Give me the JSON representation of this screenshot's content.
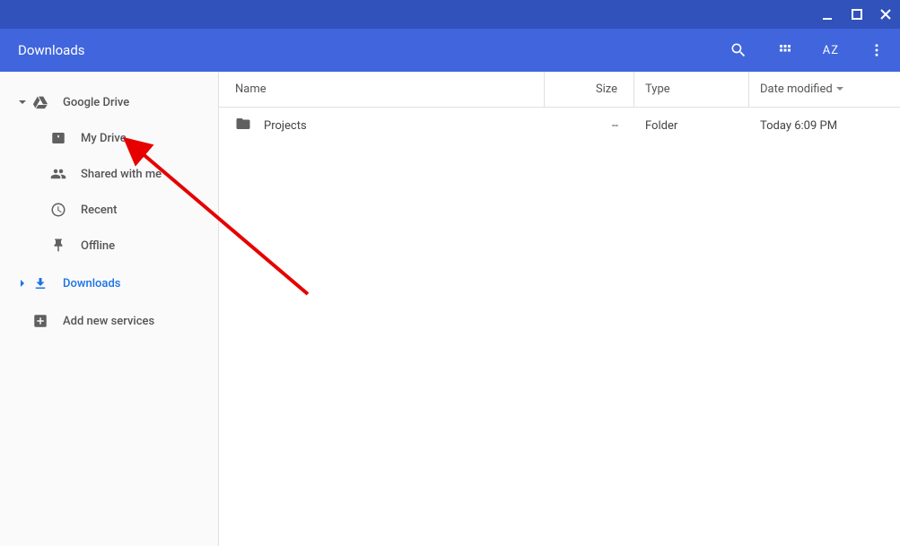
{
  "header": {
    "title": "Downloads"
  },
  "sidebar": {
    "root": {
      "label": "Google Drive"
    },
    "children": [
      {
        "label": "My Drive"
      },
      {
        "label": "Shared with me"
      },
      {
        "label": "Recent"
      },
      {
        "label": "Offline"
      }
    ],
    "downloads": {
      "label": "Downloads"
    },
    "addnew": {
      "label": "Add new services"
    }
  },
  "columns": {
    "name": "Name",
    "size": "Size",
    "type": "Type",
    "date": "Date modified"
  },
  "files": [
    {
      "name": "Projects",
      "size": "--",
      "type": "Folder",
      "date": "Today 6:09 PM"
    }
  ],
  "sort_text": "AZ"
}
